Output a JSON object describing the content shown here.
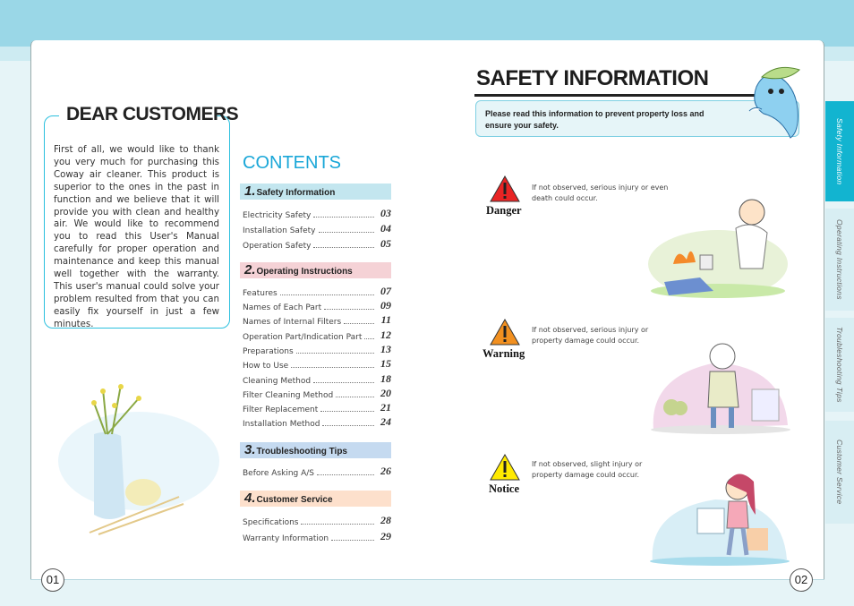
{
  "left_page": {
    "dear_title": "DEAR CUSTOMERS",
    "dear_text": "First of all, we would like to thank you very much for purchasing this Coway air cleaner. This product is superior to the ones in the past in function and we believe that it will provide you with clean and healthy air. We would like to recommend you to read this User's Manual carefully for proper operation and maintenance and keep this manual well together with the warranty. This user's manual could solve your problem resulted from that you can easily fix yourself in just a few minutes.",
    "page_number": "01"
  },
  "contents": {
    "title": "CONTENTS",
    "sections": [
      {
        "num": "1.",
        "title": "Safety Information",
        "color": "#c3e6ef",
        "items": [
          {
            "label": "Electricity Safety",
            "page": "03"
          },
          {
            "label": "Installation Safety",
            "page": "04"
          },
          {
            "label": "Operation Safety",
            "page": "05"
          }
        ]
      },
      {
        "num": "2.",
        "title": "Operating Instructions",
        "color": "#f5d2d6",
        "items": [
          {
            "label": "Features",
            "page": "07"
          },
          {
            "label": "Names of Each Part",
            "page": "09"
          },
          {
            "label": "Names of Internal Filters",
            "page": "11"
          },
          {
            "label": "Operation Part/Indication Part",
            "page": "12"
          },
          {
            "label": "Preparations",
            "page": "13"
          },
          {
            "label": "How to Use",
            "page": "15"
          },
          {
            "label": "Cleaning Method",
            "page": "18"
          },
          {
            "label": "Filter Cleaning Method",
            "page": "20"
          },
          {
            "label": "Filter Replacement",
            "page": "21"
          },
          {
            "label": "Installation Method",
            "page": "24"
          }
        ]
      },
      {
        "num": "3.",
        "title": "Troubleshooting Tips",
        "color": "#c5daf0",
        "items": [
          {
            "label": "Before Asking A/S",
            "page": "26"
          }
        ]
      },
      {
        "num": "4.",
        "title": "Customer Service",
        "color": "#fde0cc",
        "items": [
          {
            "label": "Specifications",
            "page": "28"
          },
          {
            "label": "Warranty Information",
            "page": "29"
          }
        ]
      }
    ]
  },
  "right_page": {
    "title": "SAFETY INFORMATION",
    "intro": "Please read this information to prevent property loss and ensure your safety.",
    "levels": [
      {
        "label": "Danger",
        "text": "If not observed, serious injury or even death could occur.",
        "color": "#e82424",
        "icon": "warning-triangle-icon"
      },
      {
        "label": "Warning",
        "text": "If not observed, serious injury or property damage could occur.",
        "color": "#f29020",
        "icon": "warning-triangle-icon"
      },
      {
        "label": "Notice",
        "text": "If not observed, slight injury or property damage could occur.",
        "color": "#ffea00",
        "icon": "warning-triangle-icon"
      }
    ],
    "page_number": "02"
  },
  "side_tabs": [
    {
      "label": "Safety Information",
      "active": true
    },
    {
      "label": "Operating Instructions",
      "active": false
    },
    {
      "label": "Troubleshooting Tips",
      "active": false
    },
    {
      "label": "Customer Service",
      "active": false
    }
  ],
  "colors": {
    "accent": "#12b4d0",
    "contents_title": "#1aa7d8"
  }
}
